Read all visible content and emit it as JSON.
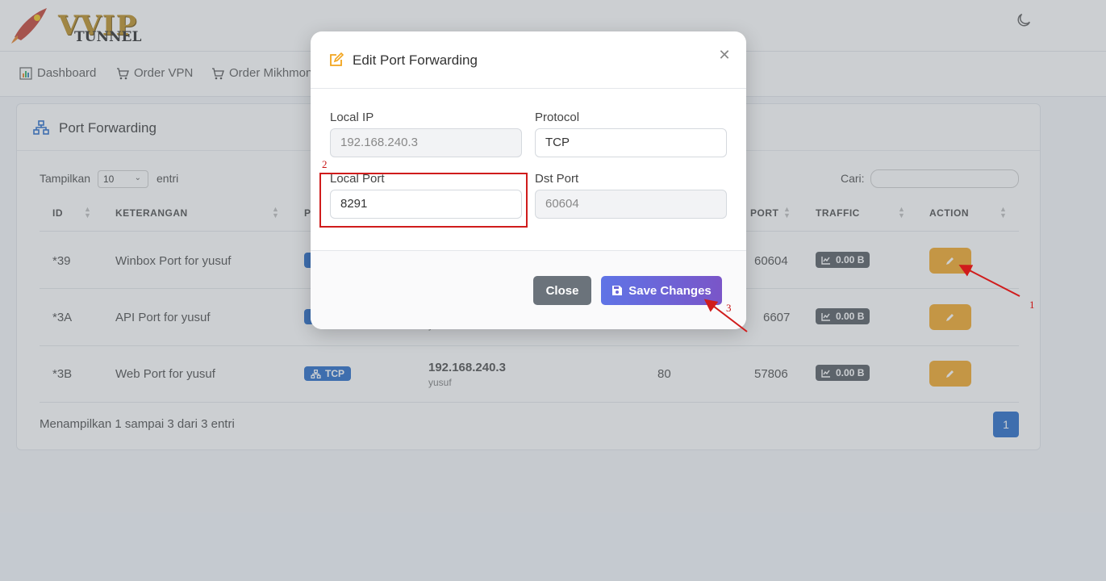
{
  "header": {
    "logo_text": "VVIP",
    "logo_sub": "TUNNEL"
  },
  "nav": {
    "items": [
      {
        "label": "Dashboard",
        "icon": "chart-bar-icon"
      },
      {
        "label": "Order VPN",
        "icon": "cart-icon"
      },
      {
        "label": "Order Mikhmon",
        "icon": "cart-icon"
      }
    ]
  },
  "card": {
    "title": "Port Forwarding",
    "length": {
      "label": "Tampilkan",
      "value": "10",
      "after": "entri"
    },
    "search": {
      "label": "Cari:",
      "value": ""
    },
    "columns": [
      "ID",
      "KETERANGAN",
      "P",
      "PORT",
      "TRAFFIC",
      "ACTION"
    ],
    "rows": [
      {
        "id": "*39",
        "desc": "Winbox Port for yusuf",
        "dst_port": "60604",
        "traffic": "0.00 B"
      },
      {
        "id": "*3A",
        "desc": "API Port for yusuf",
        "dst_port": "6607",
        "traffic": "0.00 B"
      },
      {
        "id": "*3B",
        "desc": "Web Port for yusuf",
        "protocol": "TCP",
        "ip": "192.168.240.3",
        "user": "yusuf",
        "local_port": "80",
        "dst_port": "57806",
        "traffic": "0.00 B"
      }
    ],
    "row2_user": "y",
    "info": "Menampilkan 1 sampai 3 dari 3 entri",
    "page": "1"
  },
  "modal": {
    "title": "Edit Port Forwarding",
    "fields": {
      "local_ip": {
        "label": "Local IP",
        "value": "192.168.240.3"
      },
      "protocol": {
        "label": "Protocol",
        "value": "TCP"
      },
      "local_port": {
        "label": "Local Port",
        "value": "8291"
      },
      "dst_port": {
        "label": "Dst Port",
        "value": "60604"
      }
    },
    "close_label": "Close",
    "save_label": "Save Changes"
  },
  "annotations": {
    "n1": "1",
    "n2": "2",
    "n3": "3",
    "color": "#d01c1c"
  }
}
